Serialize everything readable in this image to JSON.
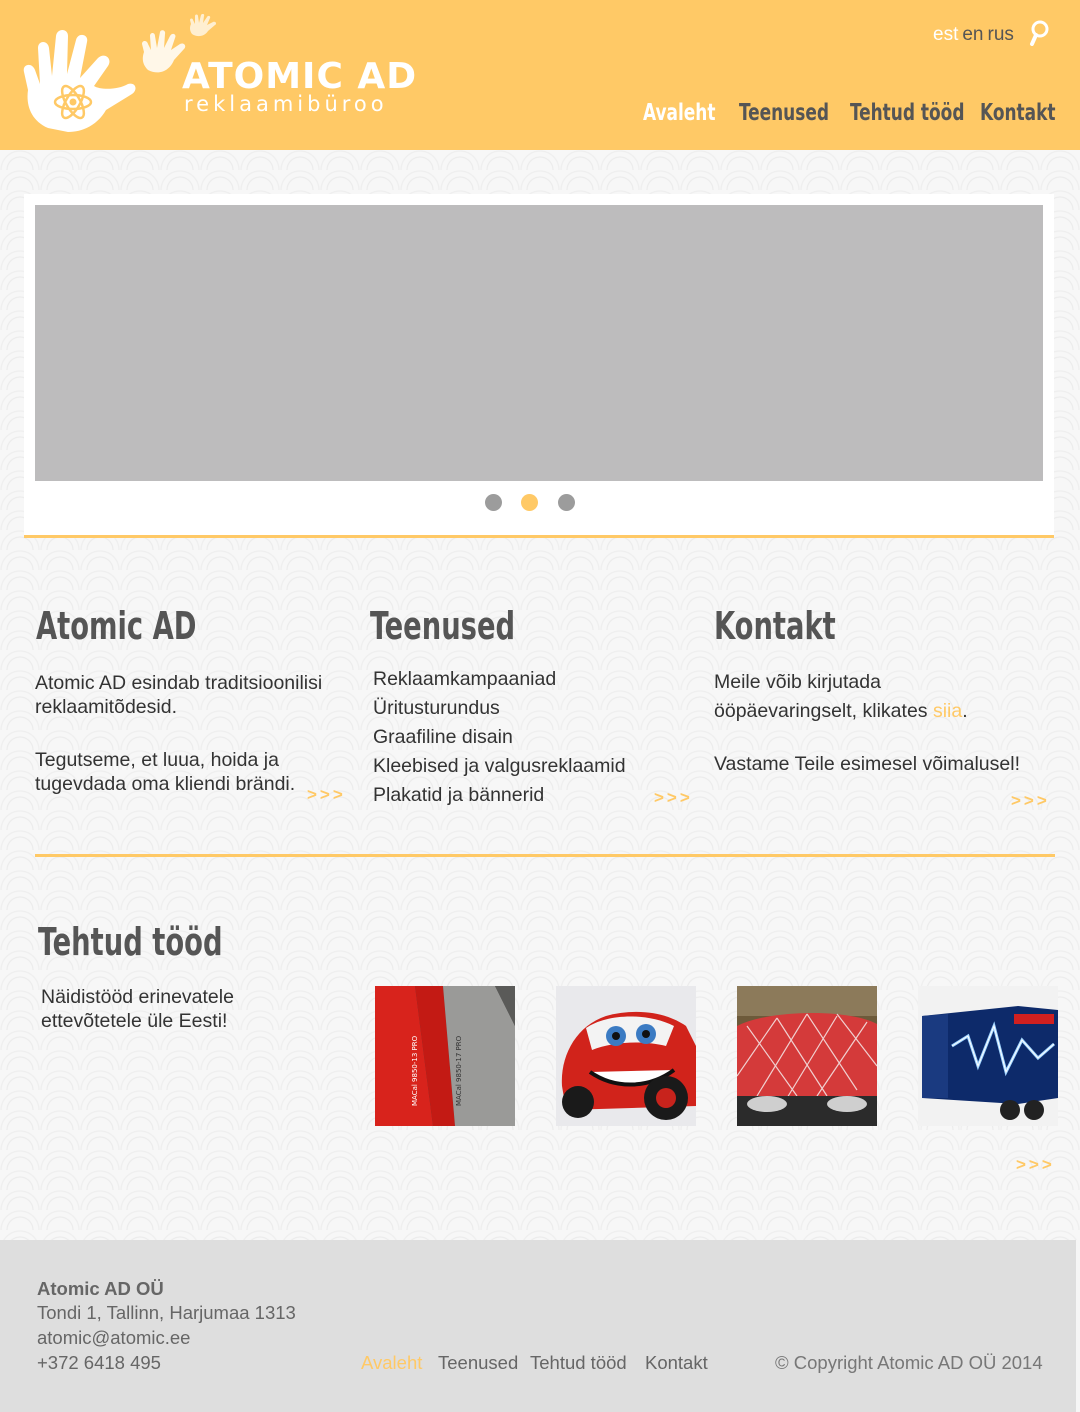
{
  "header": {
    "brand": "ATOMIC AD",
    "tagline": "reklaamibüroo",
    "languages": [
      {
        "label": "est",
        "active": true
      },
      {
        "label": "en",
        "active": false
      },
      {
        "label": "rus",
        "active": false
      }
    ],
    "search_icon": "search-icon",
    "nav": [
      {
        "label": "Avaleht",
        "active": true
      },
      {
        "label": "Teenused",
        "active": false
      },
      {
        "label": "Tehtud tööd",
        "active": false
      },
      {
        "label": "Kontakt",
        "active": false
      }
    ]
  },
  "slider": {
    "dots": 3,
    "active_dot": 2
  },
  "sections": {
    "about": {
      "title": "Atomic AD",
      "paragraph1": "Atomic AD esindab traditsioonilisi reklaamitõdesid.",
      "paragraph2": "Tegutseme, et luua, hoida ja tugevdada oma kliendi brändi.",
      "more": ">>>"
    },
    "services": {
      "title": "Teenused",
      "items": [
        "Reklaamkampaaniad",
        "Üritusturundus",
        "Graafiline disain",
        "Kleebised ja valgusreklaamid",
        "Plakatid ja bännerid"
      ],
      "more": ">>>"
    },
    "contact": {
      "title": "Kontakt",
      "line1": "Meile võib kirjutada",
      "line2_prefix": "ööpäevaringselt, klikates ",
      "line2_link": "siia",
      "line2_suffix": ".",
      "paragraph2": "Vastame Teile esimesel võimalusel!",
      "more": ">>>"
    }
  },
  "works": {
    "title": "Tehtud tööd",
    "description": "Näidistööd erinevatele ettevõtetele üle Eesti!",
    "thumbnails": [
      "red-grey-panels",
      "cars-character",
      "decorated-car-hood",
      "branded-trailer"
    ],
    "thumb_texts": [
      "MACal 9850-13 PRO",
      "MACal 9850-17 PRO"
    ],
    "more": ">>>"
  },
  "footer": {
    "company": "Atomic AD OÜ",
    "address": "Tondi 1, Tallinn, Harjumaa 1313",
    "email": "atomic@atomic.ee",
    "phone": "+372 6418 495",
    "nav": [
      {
        "label": "Avaleht",
        "active": true
      },
      {
        "label": "Teenused",
        "active": false
      },
      {
        "label": "Tehtud tööd",
        "active": false
      },
      {
        "label": "Kontakt",
        "active": false
      }
    ],
    "copyright": "© Copyright Atomic AD OÜ 2014"
  },
  "colors": {
    "accent": "#ffc966",
    "text": "#333333",
    "footer_bg": "#dedede",
    "slide_bg": "#bdbcbd"
  }
}
